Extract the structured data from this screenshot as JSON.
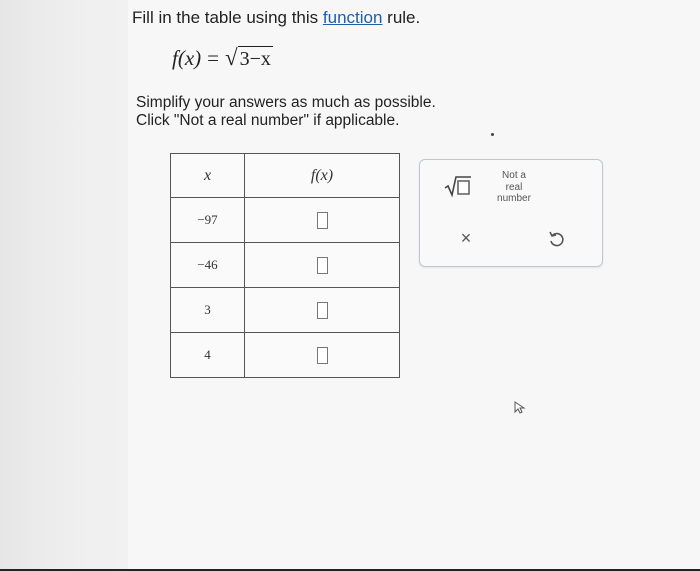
{
  "instruction": {
    "prefix": "Fill in the table using this ",
    "link": "function",
    "suffix": " rule."
  },
  "formula": {
    "lhs": "f(x)",
    "equals": "=",
    "radicand": "3−x"
  },
  "notes": {
    "line1": "Simplify your answers as much as possible.",
    "line2": "Click \"Not a real number\" if applicable."
  },
  "table": {
    "header_x": "x",
    "header_fx": "f(x)",
    "rows": [
      {
        "x": "−97"
      },
      {
        "x": "−46"
      },
      {
        "x": "3"
      },
      {
        "x": "4"
      }
    ]
  },
  "palette": {
    "not_real_line1": "Not a",
    "not_real_line2": "real",
    "not_real_line3": "number",
    "clear_label": "×"
  },
  "colors": {
    "link": "#1f5fa8",
    "palette_border": "#bfc7cf"
  }
}
